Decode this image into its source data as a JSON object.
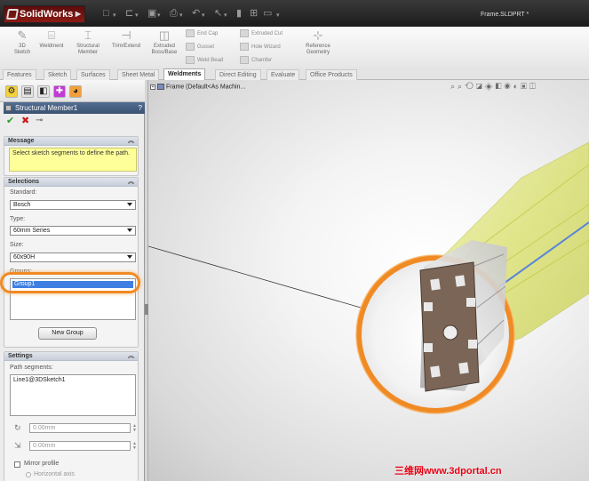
{
  "app": {
    "brand": "SolidWorks",
    "document_title": "Frame.SLDPRT *"
  },
  "ribbon": {
    "big_buttons": [
      {
        "label": "3D\nSketch",
        "icon": "sketch-3d-icon"
      },
      {
        "label": "Weldment",
        "icon": "weldment-icon"
      },
      {
        "label": "Structural\nMember",
        "icon": "structural-member-icon"
      },
      {
        "label": "Trim/Extend",
        "icon": "trim-extend-icon"
      },
      {
        "label": "Extruded\nBoss/Base",
        "icon": "extruded-boss-icon"
      }
    ],
    "small_buttons": [
      {
        "label": "End Cap",
        "icon": "end-cap-icon"
      },
      {
        "label": "Gusset",
        "icon": "gusset-icon"
      },
      {
        "label": "Weld Bead",
        "icon": "weld-bead-icon"
      },
      {
        "label": "Extruded Cut",
        "icon": "extruded-cut-icon"
      },
      {
        "label": "Hole Wizard",
        "icon": "hole-wizard-icon"
      },
      {
        "label": "Chamfer",
        "icon": "chamfer-icon"
      }
    ],
    "reference_geometry": "Reference\nGeometry"
  },
  "tabs": [
    "Features",
    "Sketch",
    "Surfaces",
    "Sheet Metal",
    "Weldments",
    "Direct Editing",
    "Evaluate",
    "Office Products"
  ],
  "active_tab": "Weldments",
  "property_manager": {
    "title": "Structural Member1",
    "help": "?",
    "message": {
      "header": "Message",
      "text": "Select sketch segments to define the path."
    },
    "selections": {
      "header": "Selections",
      "standard_label": "Standard:",
      "standard_value": "Bosch",
      "type_label": "Type:",
      "type_value": "60mm Series",
      "size_label": "Size:",
      "size_value": "60x90H",
      "groups_label": "Groups:",
      "groups_items": [
        "Group1"
      ],
      "new_group_button": "New Group"
    },
    "settings": {
      "header": "Settings",
      "path_segments_label": "Path segments:",
      "path_segments_items": [
        "Line1@3DSketch1"
      ],
      "angle_value": "0.00mm",
      "offset_value": "0.00mm",
      "mirror_profile_label": "Mirror profile",
      "horizontal_axis_label": "Horizontal axis"
    }
  },
  "viewport": {
    "tree_item": "Frame (Default<As Machin..."
  },
  "watermark": "三维网www.3dportal.cn",
  "colors": {
    "accent_orange": "#f08a24",
    "profile_brown": "#7a6556",
    "beam_yellow": "#d7df5a",
    "pm_header": "#3a5272",
    "message_bg": "#ffff99"
  }
}
